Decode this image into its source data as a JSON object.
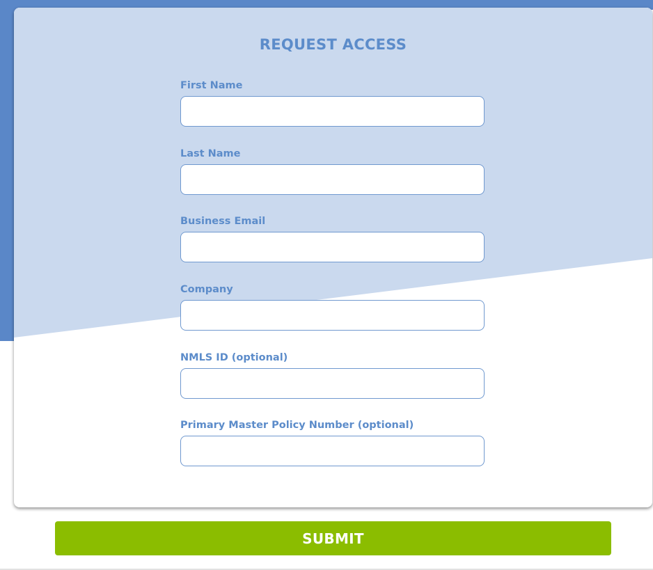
{
  "form": {
    "title": "REQUEST ACCESS",
    "fields": [
      {
        "label": "First Name",
        "value": "",
        "placeholder": ""
      },
      {
        "label": "Last Name",
        "value": "",
        "placeholder": ""
      },
      {
        "label": "Business Email",
        "value": "",
        "placeholder": ""
      },
      {
        "label": "Company",
        "value": "",
        "placeholder": ""
      },
      {
        "label": "NMLS ID (optional)",
        "value": "",
        "placeholder": ""
      },
      {
        "label": "Primary Master Policy Number (optional)",
        "value": "",
        "placeholder": ""
      }
    ],
    "submit_label": "SUBMIT"
  },
  "colors": {
    "accent": "#5c8cca",
    "background_band": "#5a87c8",
    "panel_tint": "#cad9ee",
    "input_border": "#6f98cf",
    "submit": "#8bbd00",
    "submit_text": "#ffffff"
  }
}
